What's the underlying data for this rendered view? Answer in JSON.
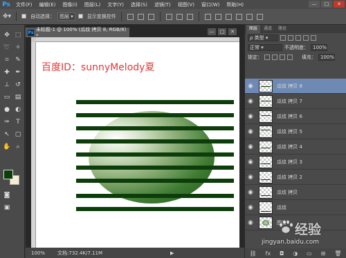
{
  "app": {
    "logo": "Ps"
  },
  "menu": [
    "文件(F)",
    "编辑(E)",
    "图像(I)",
    "图层(L)",
    "文字(Y)",
    "选择(S)",
    "滤镜(T)",
    "视图(V)",
    "窗口(W)",
    "帮助(H)"
  ],
  "window_controls": {
    "minimize": "—",
    "restore": "□",
    "close": "✕"
  },
  "options": {
    "auto_select_label": "自动选择：",
    "auto_select_value": "图层",
    "show_transform_label": "显示变换控件"
  },
  "document": {
    "tab_title": "未标题-1 @ 100% (瓜纹 拷贝 8, RGB/8) *",
    "canvas_text": "百度ID：sunnyMelody夏",
    "zoom": "100%",
    "doc_size": "文档:732.4K/7.11M"
  },
  "colors": {
    "foreground": "#0c3d0a",
    "background": "#f5ecd4",
    "stripe": "#0c3d0a",
    "text": "#e0383a",
    "selection": "#6d89b4"
  },
  "panels": {
    "tabs": [
      "图层",
      "通道",
      "路径"
    ],
    "filter_kind": "类型",
    "blend_mode": "正常",
    "opacity_label": "不透明度：",
    "opacity_value": "100%",
    "lock_label": "锁定：",
    "fill_label": "填充：",
    "fill_value": "100%",
    "layers": [
      {
        "name": "瓜纹 拷贝 8",
        "selected": true,
        "thumb": "stripe"
      },
      {
        "name": "瓜纹 拷贝 7",
        "selected": false,
        "thumb": "stripe"
      },
      {
        "name": "瓜纹 拷贝 6",
        "selected": false,
        "thumb": "stripe"
      },
      {
        "name": "瓜纹 拷贝 5",
        "selected": false,
        "thumb": "stripe"
      },
      {
        "name": "瓜纹 拷贝 4",
        "selected": false,
        "thumb": "stripe"
      },
      {
        "name": "瓜纹 拷贝 3",
        "selected": false,
        "thumb": "stripe"
      },
      {
        "name": "瓜纹 拷贝 2",
        "selected": false,
        "thumb": "stripe"
      },
      {
        "name": "瓜纹 拷贝",
        "selected": false,
        "thumb": "stripe"
      },
      {
        "name": "瓜纹",
        "selected": false,
        "thumb": "stripe"
      },
      {
        "name": "图层",
        "selected": false,
        "thumb": "ball"
      }
    ]
  },
  "site_watermark": {
    "logo_text": "经验",
    "url": "jingyan.baidu.com"
  }
}
